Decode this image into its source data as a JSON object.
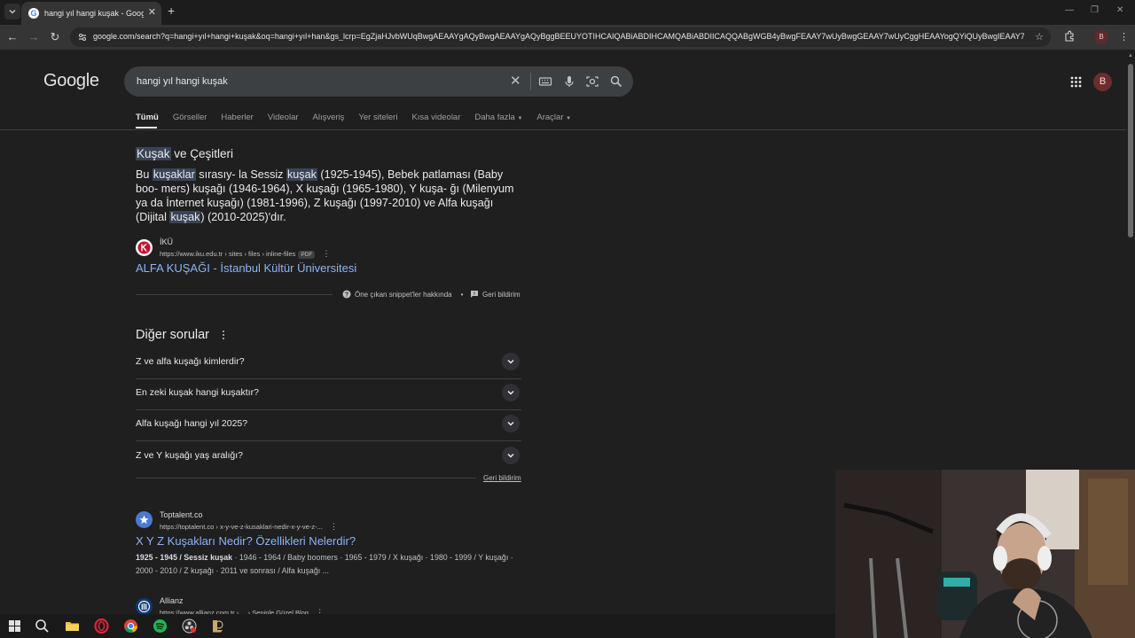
{
  "browser": {
    "tab_title": "hangi yıl hangi kuşak - Google'da Ara",
    "url": "google.com/search?q=hangi+yıl+hangi+kuşak&oq=hangi+yıl+han&gs_lcrp=EgZjaHJvbWUqBwgAEAAYgAQyBwgAEAAYgAQyBggBEEUYOTIHCAIQABiABDIHCAMQABiABDIICAQQABgWGB4yBwgFEAAY7wUyBwgGEAAY7wUyCggHEAAYogQYiQUyBwgIEAAY7...",
    "profile_initial": "B"
  },
  "google": {
    "logo": "Google",
    "query": "hangi yıl hangi kuşak",
    "avatar_initial": "B",
    "tabs": [
      "Tümü",
      "Görseller",
      "Haberler",
      "Videolar",
      "Alışveriş",
      "Yer siteleri",
      "Kısa videolar",
      "Daha fazla",
      "Araçlar"
    ]
  },
  "snippet": {
    "title_hl": "Kuşak",
    "title_rest": " ve Çeşitleri",
    "body": {
      "p1": "Bu ",
      "h1": "kuşaklar",
      "p2": " sırasıy- la Sessiz ",
      "h2": "kuşak",
      "p3": " (1925-1945), Bebek patlaması (Baby boo- mers) kuşağı (1946-1964), X kuşağı (1965-1980), Y kuşa- ğı (Milenyum ya da İnternet kuşağı) (1981-1996), Z kuşağı (1997-2010) ve Alfa kuşağı (Dijital ",
      "h3": "kuşak",
      "p4": ") (2010-2025)'dır."
    },
    "source_name": "İKÜ",
    "source_url": "https://www.iku.edu.tr › sites › files › inline-files",
    "pdf_label": "PDF",
    "source_title": "ALFA KUŞAĞI - İstanbul Kültür Üniversitesi",
    "about_label": "Öne çıkan snippet'ler hakkında",
    "feedback_label": "Geri bildirim"
  },
  "paa": {
    "title": "Diğer sorular",
    "questions": [
      "Z ve alfa kuşağı kimlerdir?",
      "En zeki kuşak hangi kuşaktır?",
      "Alfa kuşağı hangi yıl 2025?",
      "Z ve Y kuşağı yaş aralığı?"
    ],
    "feedback_label": "Geri bildirim"
  },
  "results": [
    {
      "site": "Toptalent.co",
      "url": "https://toptalent.co › x-y-ve-z-kusaklari-nedir-x-y-ve-z-...",
      "title": "X Y Z Kuşakları Nedir? Özellikleri Nelerdir?",
      "snippet_bold": "1925 - 1945 / Sessiz kuşak",
      "snippet": " · 1946 - 1964 / Baby boomers · 1965 - 1979 / X kuşağı · 1980 - 1999 / Y kuşağı · 2000 - 2010 / Z kuşağı · 2011 ve sonrası / Alfa kuşağı ..."
    },
    {
      "site": "Allianz",
      "url": "https://www.allianz.com.tr › ... › Seninle Güzel Blog"
    }
  ],
  "colors": {
    "page_bg": "#1f1f1f",
    "link": "#8ab4f8",
    "highlight": "#394457"
  }
}
